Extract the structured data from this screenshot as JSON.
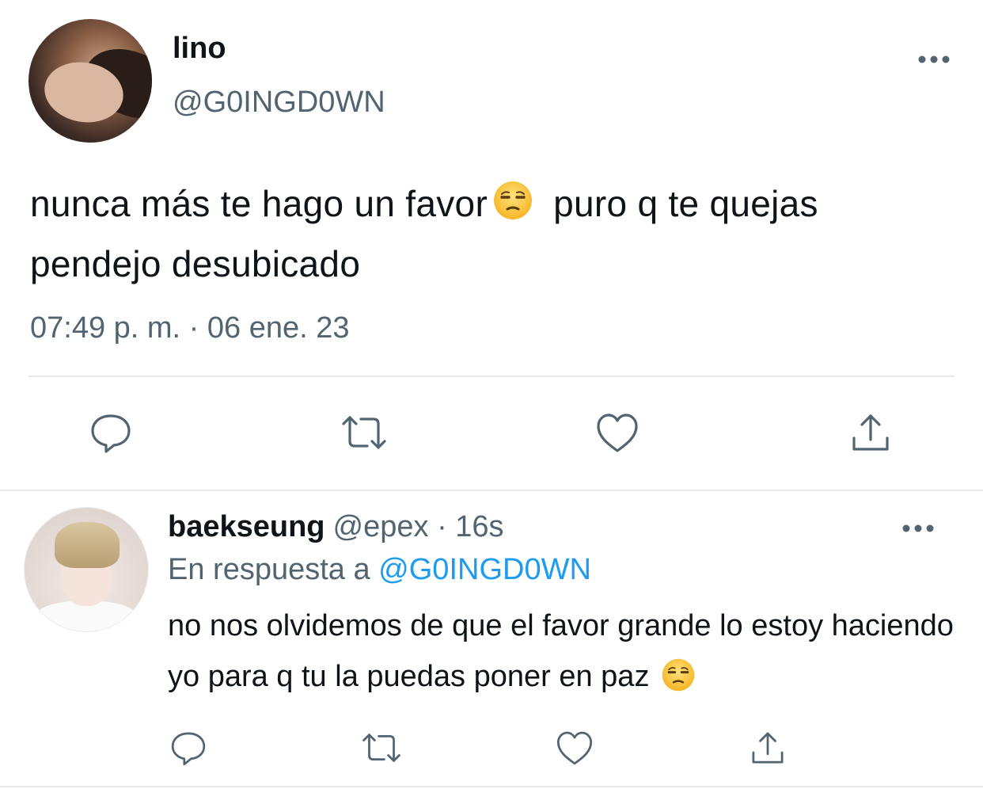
{
  "tweet": {
    "author_name": "lino",
    "author_handle": "@G0INGD0WN",
    "text_part1": "nunca más te hago un favor",
    "emoji": "unamused-face",
    "text_part2": "puro q te quejas pendejo desubicado",
    "timestamp": "07:49 p. m. · 06 ene. 23",
    "actions": [
      "reply-icon",
      "retweet-icon",
      "like-icon",
      "share-icon"
    ]
  },
  "reply": {
    "author_name": "baekseung",
    "author_handle": "@epex · 16s",
    "replying_to_prefix": "En respuesta a ",
    "replying_to_handle": "@G0INGD0WN",
    "text": "no nos olvidemos de que el favor grande lo estoy haciendo yo para q tu la puedas poner en paz",
    "emoji": "unamused-face",
    "actions": [
      "reply-icon",
      "retweet-icon",
      "like-icon",
      "share-icon"
    ]
  },
  "colors": {
    "text": "#0f1419",
    "secondary": "#536471",
    "accent": "#1d9bf0",
    "divider": "#e6e9ec"
  }
}
